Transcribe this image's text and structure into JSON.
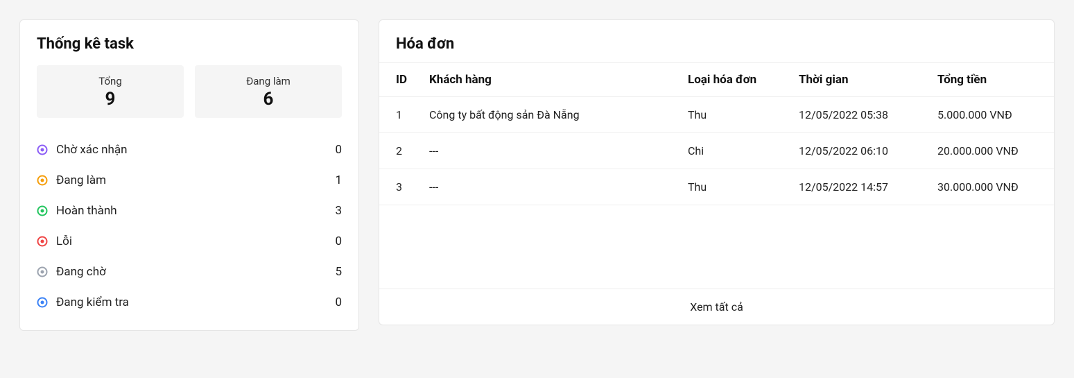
{
  "stats": {
    "title": "Thống kê task",
    "summary": [
      {
        "label": "Tổng",
        "value": "9"
      },
      {
        "label": "Đang làm",
        "value": "6"
      }
    ],
    "statuses": [
      {
        "icon_color": "#8b5cf6",
        "label": "Chờ xác nhận",
        "count": "0"
      },
      {
        "icon_color": "#f59e0b",
        "label": "Đang làm",
        "count": "1"
      },
      {
        "icon_color": "#22c55e",
        "label": "Hoàn thành",
        "count": "3"
      },
      {
        "icon_color": "#ef4444",
        "label": "Lỗi",
        "count": "0"
      },
      {
        "icon_color": "#9ca3af",
        "label": "Đang chờ",
        "count": "5"
      },
      {
        "icon_color": "#3b82f6",
        "label": "Đang kiểm tra",
        "count": "0"
      }
    ]
  },
  "invoices": {
    "title": "Hóa đơn",
    "headers": {
      "id": "ID",
      "customer": "Khách hàng",
      "type": "Loại hóa đơn",
      "time": "Thời gian",
      "total": "Tổng tiền"
    },
    "rows": [
      {
        "id": "1",
        "customer": "Công ty bất động sản Đà Nẵng",
        "type": "Thu",
        "time": "12/05/2022 05:38",
        "total": "5.000.000 VNĐ"
      },
      {
        "id": "2",
        "customer": "---",
        "type": "Chi",
        "time": "12/05/2022 06:10",
        "total": "20.000.000 VNĐ"
      },
      {
        "id": "3",
        "customer": "---",
        "type": "Thu",
        "time": "12/05/2022 14:57",
        "total": "30.000.000 VNĐ"
      }
    ],
    "view_all": "Xem tất cả"
  }
}
